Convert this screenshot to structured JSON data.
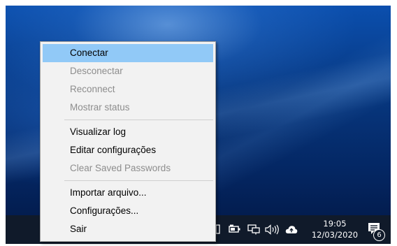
{
  "context_menu": {
    "items": [
      {
        "label": "Conectar",
        "enabled": true,
        "highlighted": true
      },
      {
        "label": "Desconectar",
        "enabled": false
      },
      {
        "label": "Reconnect",
        "enabled": false
      },
      {
        "label": "Mostrar status",
        "enabled": false
      },
      {
        "label": "Visualizar log",
        "enabled": true
      },
      {
        "label": "Editar configurações",
        "enabled": true
      },
      {
        "label": "Clear Saved Passwords",
        "enabled": false
      },
      {
        "label": "Importar arquivo...",
        "enabled": true
      },
      {
        "label": "Configurações...",
        "enabled": true
      },
      {
        "label": "Sair",
        "enabled": true
      }
    ],
    "highlight_color": "#91c9f7",
    "disabled_color": "#8d8d8d"
  },
  "taskbar": {
    "tray_icons": [
      "tray-app-icon",
      "battery-icon",
      "network-icon",
      "volume-icon",
      "cloud-icon"
    ],
    "time": "19:05",
    "date": "12/03/2020",
    "notification_count": "6",
    "background_color": "#101a2a"
  }
}
